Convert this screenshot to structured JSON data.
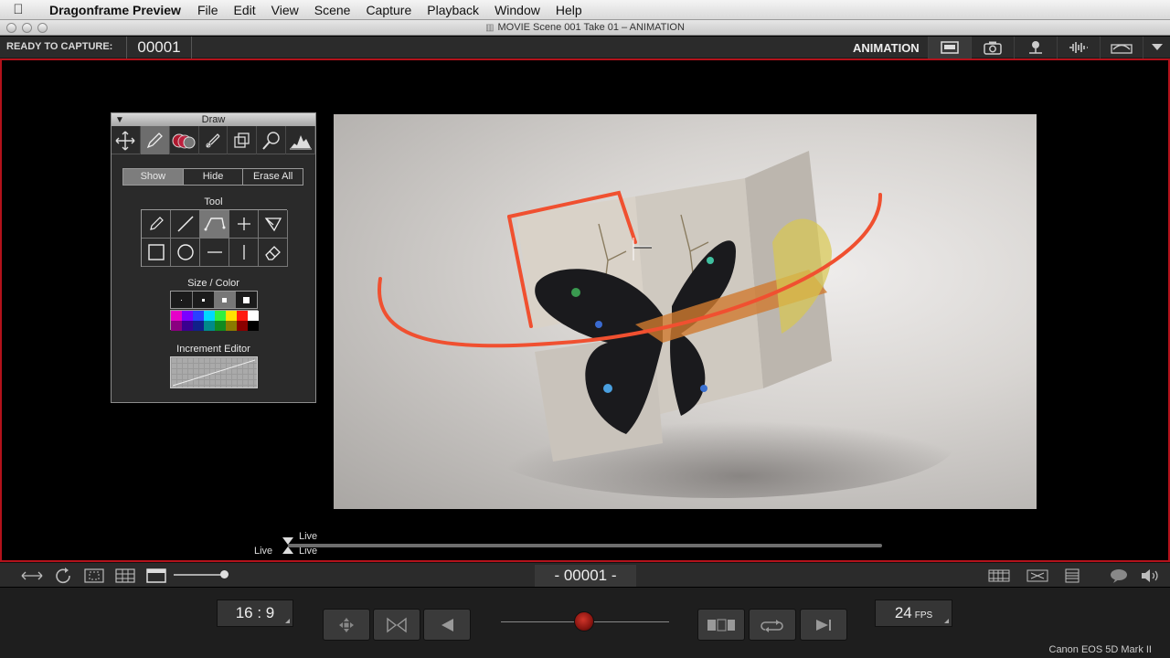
{
  "menubar": {
    "app_name": "Dragonframe Preview",
    "items": [
      "File",
      "Edit",
      "View",
      "Scene",
      "Capture",
      "Playback",
      "Window",
      "Help"
    ]
  },
  "window": {
    "title": "MOVIE  Scene 001  Take 01 – ANIMATION"
  },
  "status": {
    "ready_label": "READY TO CAPTURE:",
    "frame": "00001",
    "mode": "ANIMATION",
    "icons": [
      "frame-view-icon",
      "camera-icon",
      "light-icon",
      "audio-icon",
      "motion-control-icon",
      "dropdown-icon"
    ]
  },
  "draw_panel": {
    "title": "Draw",
    "tabs": [
      "move-icon",
      "pencil-icon",
      "color-layers-icon",
      "pen-icon",
      "layers-icon",
      "magnifier-icon",
      "histogram-icon"
    ],
    "visibility": [
      "Show",
      "Hide",
      "Erase All"
    ],
    "tool_label": "Tool",
    "tools": [
      "pencil-tool-icon",
      "line-tool-icon",
      "curve-tool-icon",
      "crosshair-tool-icon",
      "arrow-tool-icon",
      "rectangle-tool-icon",
      "circle-tool-icon",
      "horizontal-line-tool-icon",
      "vertical-line-tool-icon",
      "eraser-tool-icon"
    ],
    "size_color_label": "Size / Color",
    "palette": [
      "#e600c8",
      "#7a00ff",
      "#2a40ff",
      "#00d8ff",
      "#30f040",
      "#ffe000",
      "#ff1a10",
      "#ffffff",
      "#8a0080",
      "#3a0090",
      "#10208a",
      "#008a8a",
      "#108a20",
      "#8a7a00",
      "#8a0000",
      "#000000"
    ],
    "increment_label": "Increment Editor"
  },
  "timeline": {
    "live_top": "Live",
    "live_bottom": "Live",
    "live_left": "Live"
  },
  "lowbar": {
    "frame_display": "- 00001 -"
  },
  "controls": {
    "aspect_ratio": "16 : 9",
    "fps_value": "24",
    "fps_unit": "FPS",
    "camera_name": "Canon EOS 5D Mark II"
  },
  "colors": {
    "accent_border": "#b3121b",
    "drawing_stroke": "#f05030"
  }
}
